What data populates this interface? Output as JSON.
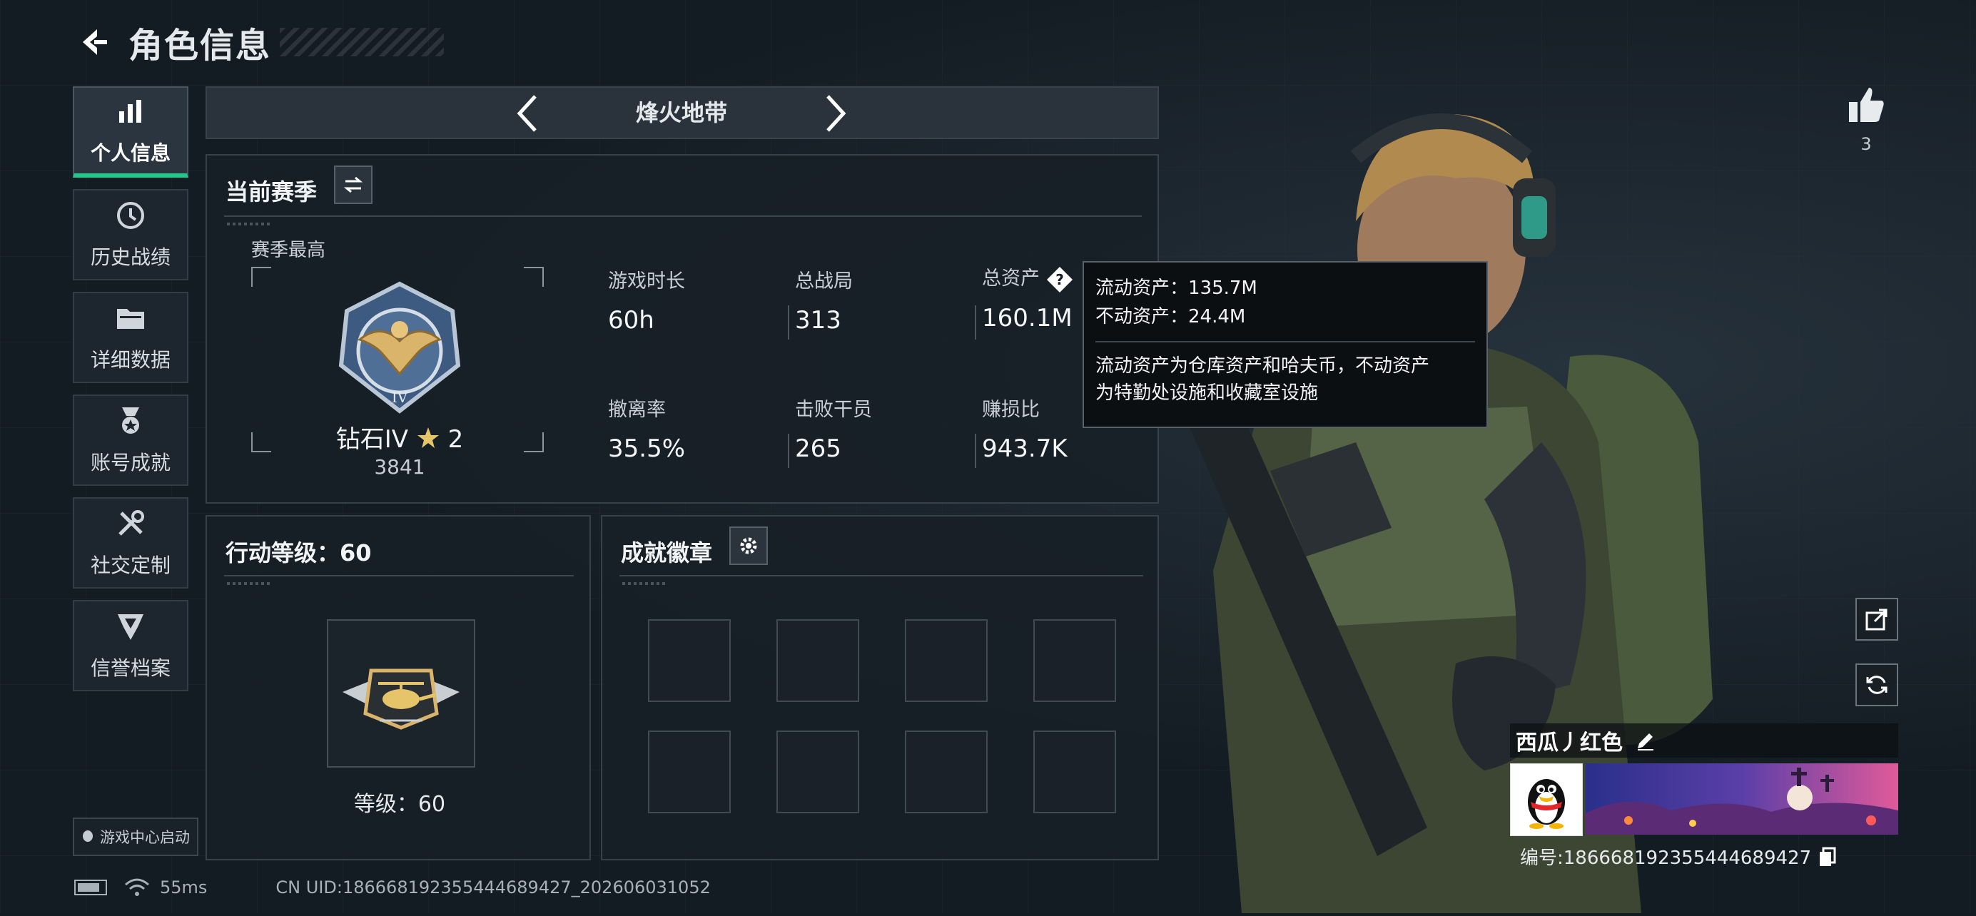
{
  "header": {
    "title": "角色信息"
  },
  "sidebar": {
    "items": [
      {
        "label": "个人信息",
        "icon": "bar-chart-icon",
        "active": true
      },
      {
        "label": "历史战绩",
        "icon": "history-icon",
        "active": false
      },
      {
        "label": "详细数据",
        "icon": "folder-icon",
        "active": false
      },
      {
        "label": "账号成就",
        "icon": "medal-icon",
        "active": false
      },
      {
        "label": "社交定制",
        "icon": "tools-icon",
        "active": false
      },
      {
        "label": "信誉档案",
        "icon": "shield-icon",
        "active": false
      }
    ],
    "game_center": "游戏中心启动"
  },
  "mode": {
    "name": "烽火地带"
  },
  "season": {
    "title": "当前赛季",
    "best_label": "赛季最高",
    "rank_name": "钻石IV",
    "rank_stars": "2",
    "rank_score": "3841",
    "stats": [
      {
        "label": "游戏时长",
        "value": "60h"
      },
      {
        "label": "总战局",
        "value": "313"
      },
      {
        "label": "总资产",
        "value": "160.1M"
      },
      {
        "label": "撤离率",
        "value": "35.5%"
      },
      {
        "label": "击败干员",
        "value": "265"
      },
      {
        "label": "赚损比",
        "value": "943.7K"
      }
    ]
  },
  "tooltip": {
    "liquid": "流动资产：135.7M",
    "fixed": "不动资产：24.4M",
    "note_line1": "流动资产为仓库资产和哈夫币，不动资产",
    "note_line2": "为特勤处设施和收藏室设施"
  },
  "level": {
    "title": "行动等级：60",
    "text": "等级：60"
  },
  "achievements": {
    "title": "成就徽章",
    "slots": 8
  },
  "profile": {
    "like_count": "3",
    "nickname": "西瓜丿红色",
    "uid": "编号:18666819235544468942 7",
    "uid_text": "编号:186668192355444689427"
  },
  "status": {
    "ping": "55ms",
    "uid_footer": "CN UID:186668192355444689427_202606031052"
  },
  "colors": {
    "accent": "#1fc98b",
    "panel": "#182027",
    "tooltip_bg": "#0c0f12"
  }
}
